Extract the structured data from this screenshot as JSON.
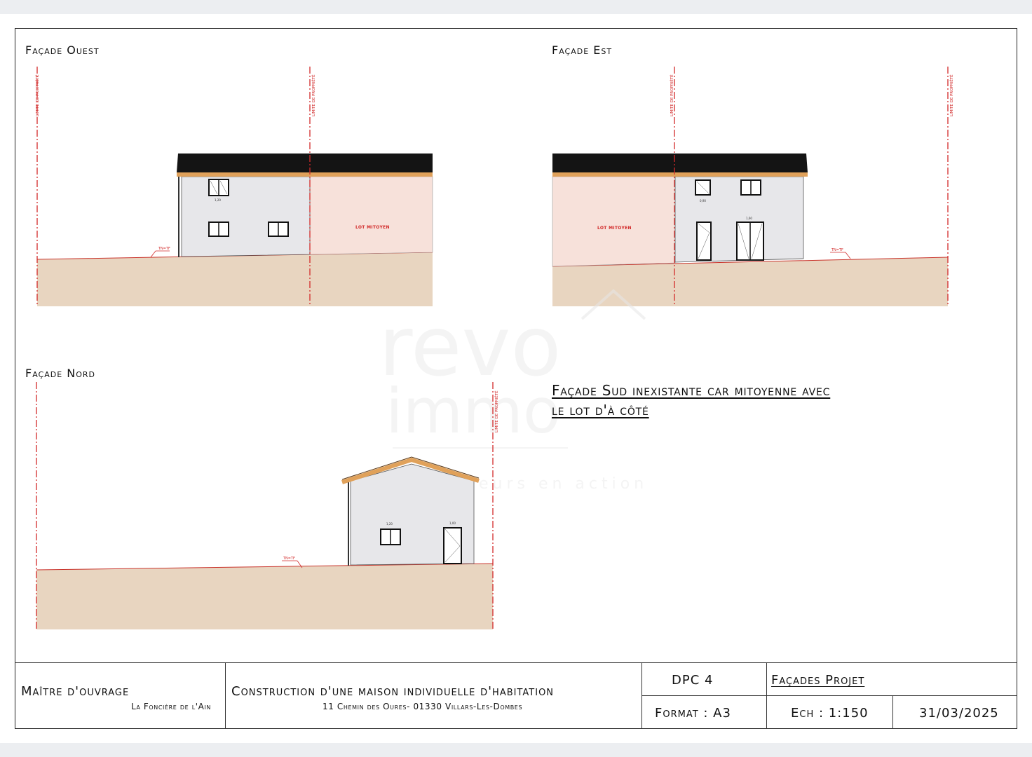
{
  "views": {
    "ouest": {
      "title": "Façade Ouest",
      "lot_label": "LOT MITOYEN",
      "tn_label": "TN=TF",
      "limite_label": "LIMITE DE PROPRIÉTÉ"
    },
    "est": {
      "title": "Façade Est",
      "lot_label": "LOT MITOYEN",
      "tn_label": "TN=TF",
      "limite_label": "LIMITE DE PROPRIÉTÉ"
    },
    "nord": {
      "title": "Façade Nord",
      "tn_label": "TN=TF",
      "limite_label": "LIMITE DE PROPRIÉTÉ"
    }
  },
  "dims": {
    "w120": "1,20",
    "w100": "1,00",
    "w90": "0,90",
    "h100": "1,00",
    "h80": "0,80",
    "h215": "2,15",
    "w160": "1,60"
  },
  "note": {
    "line1": "Façade Sud inexistante car mitoyenne avec",
    "line2": "le lot d'à côté"
  },
  "watermark": {
    "line1": "revo",
    "line2": "immo",
    "tagline": "Nos valeurs en action"
  },
  "title_block": {
    "maitre_label": "Maître d'ouvrage",
    "maitre_value": "La Foncière de l'Ain",
    "project_title": "Construction d'une maison individuelle d'habitation",
    "project_address": "11 Chemin des Oures- 01330 Villars-Les-Dombes",
    "dpc": "DPC 4",
    "sheet_title": "Façades Projet",
    "format": "Format : A3",
    "scale": "Ech : 1:150",
    "date": "31/03/2025"
  },
  "colors": {
    "ground": "#e8d5c0",
    "roof": "#141414",
    "eave": "#e0a15a",
    "wall": "#e7e7ea",
    "mitoyen": "#f7e1da",
    "limit": "#d22a2a"
  }
}
